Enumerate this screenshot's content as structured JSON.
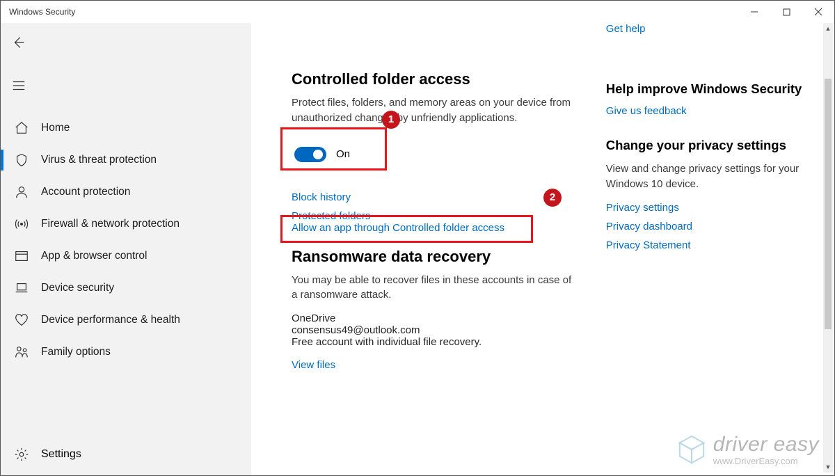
{
  "window": {
    "title": "Windows Security"
  },
  "sidebar": {
    "items": [
      {
        "label": "Home"
      },
      {
        "label": "Virus & threat protection"
      },
      {
        "label": "Account protection"
      },
      {
        "label": "Firewall & network protection"
      },
      {
        "label": "App & browser control"
      },
      {
        "label": "Device security"
      },
      {
        "label": "Device performance & health"
      },
      {
        "label": "Family options"
      }
    ],
    "settings": "Settings"
  },
  "main": {
    "cfa": {
      "title": "Controlled folder access",
      "desc": "Protect files, folders, and memory areas on your device from unauthorized changes by unfriendly applications.",
      "toggle_label": "On",
      "links": {
        "block_history": "Block history",
        "protected_folders": "Protected folders",
        "allow_app": "Allow an app through Controlled folder access"
      }
    },
    "ransom": {
      "title": "Ransomware data recovery",
      "desc": "You may be able to recover files in these accounts in case of a ransomware attack.",
      "account_name": "OneDrive",
      "account_email": "consensus49@outlook.com",
      "account_desc": "Free account with individual file recovery.",
      "view_files": "View files"
    }
  },
  "right": {
    "get_help": "Get help",
    "improve": {
      "title": "Help improve Windows Security",
      "feedback": "Give us feedback"
    },
    "privacy": {
      "title": "Change your privacy settings",
      "desc": "View and change privacy settings for your Windows 10 device.",
      "links": {
        "settings": "Privacy settings",
        "dashboard": "Privacy dashboard",
        "statement": "Privacy Statement"
      }
    }
  },
  "annotations": {
    "b1": "1",
    "b2": "2"
  },
  "watermark": {
    "line1": "driver easy",
    "line2": "www.DriverEasy.com"
  }
}
